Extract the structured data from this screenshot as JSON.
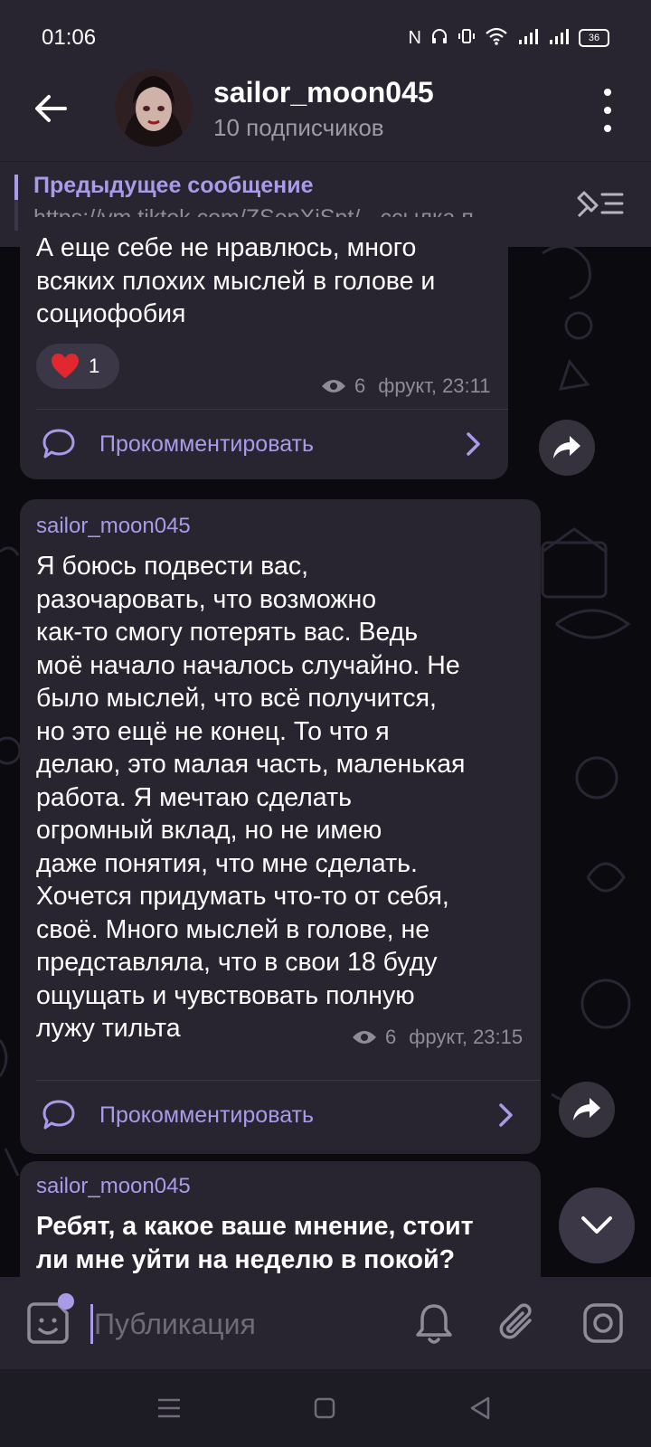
{
  "status_bar": {
    "time": "01:06",
    "battery": "36",
    "icons": [
      "nfc-icon",
      "headphones-icon",
      "vibrate-icon",
      "wifi-icon",
      "signal-icon",
      "signal-icon",
      "battery-icon"
    ]
  },
  "header": {
    "title": "sailor_moon045",
    "subtitle": "10 подписчиков"
  },
  "pinned": {
    "title": "Предыдущее сообщение",
    "text": "https://vm.tiktok.com/ZSepXjSpt/ - ссылка п..."
  },
  "messages": [
    {
      "text_lines": [
        "А еще себе не нравлюсь, много",
        "всяких плохих мыслей в голове и",
        "социофобия"
      ],
      "reaction": {
        "emoji": "heart",
        "count": "1"
      },
      "views": "6",
      "signature_time": "фрукт, 23:11",
      "comment_label": "Прокомментировать"
    },
    {
      "author": "sailor_moon045",
      "text_lines": [
        "Я боюсь подвести вас,",
        "разочаровать, что возможно",
        "как-то смогу потерять вас. Ведь",
        "моё начало началось случайно. Не",
        "было мыслей, что всё получится,",
        "но это ещё не конец. То что я",
        "делаю, это малая часть, маленькая",
        "работа. Я мечтаю сделать",
        "огромный вклад, но не имею",
        "даже понятия, что мне сделать.",
        "Хочется придумать что-то от себя,",
        "своё. Много мыслей в голове, не",
        "представляла, что в свои 18 буду",
        "ощущать и чувствовать полную",
        "лужу тильта"
      ],
      "views": "6",
      "signature_time": "фрукт, 23:15",
      "comment_label": "Прокомментировать"
    },
    {
      "author": "sailor_moon045",
      "text_lines": [
        "Ребят, а какое ваше мнение, стоит",
        "ли мне уйти на неделю в покой?"
      ]
    }
  ],
  "composer": {
    "placeholder": "Публикация"
  },
  "colors": {
    "accent": "#a89be8",
    "bubble": "#282531",
    "background": "#0b0a0f",
    "heart": "#e0282e"
  }
}
